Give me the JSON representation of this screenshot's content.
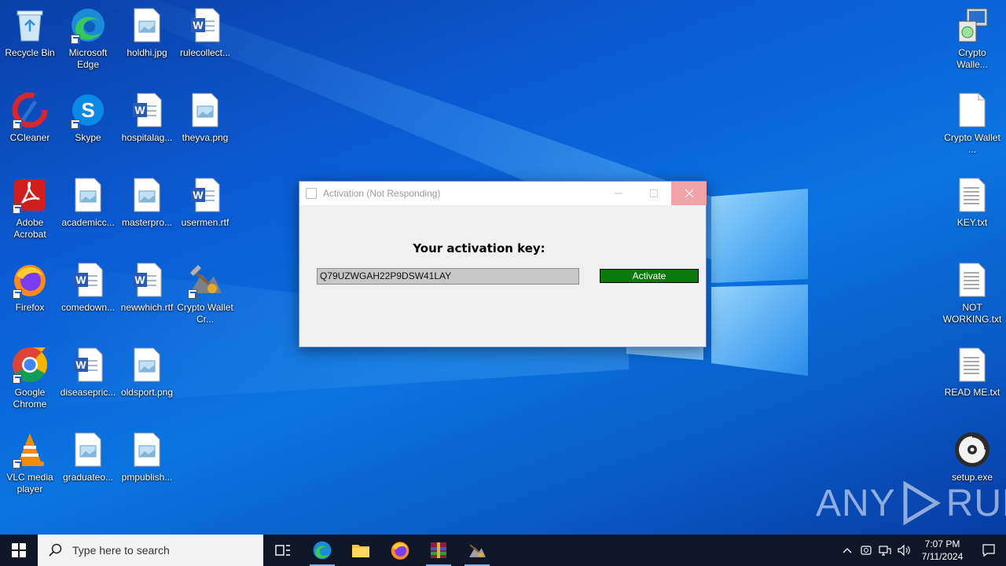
{
  "desktop_icons": [
    {
      "label": "Recycle Bin",
      "icon": "recycle-bin-icon"
    },
    {
      "label": "Microsoft Edge",
      "icon": "edge-icon"
    },
    {
      "label": "holdhi.jpg",
      "icon": "image-file-icon"
    },
    {
      "label": "rulecollect...",
      "icon": "word-doc-icon"
    },
    {
      "label": "CCleaner",
      "icon": "ccleaner-icon"
    },
    {
      "label": "Skype",
      "icon": "skype-icon"
    },
    {
      "label": "hospitalag...",
      "icon": "word-doc-icon"
    },
    {
      "label": "theyva.png",
      "icon": "image-file-icon"
    },
    {
      "label": "Adobe Acrobat",
      "icon": "acrobat-icon"
    },
    {
      "label": "academicc...",
      "icon": "image-file-icon"
    },
    {
      "label": "masterpro...",
      "icon": "image-file-icon"
    },
    {
      "label": "usermen.rtf",
      "icon": "word-doc-icon"
    },
    {
      "label": "Firefox",
      "icon": "firefox-icon"
    },
    {
      "label": "comedown...",
      "icon": "word-doc-icon"
    },
    {
      "label": "newwhich.rtf",
      "icon": "word-doc-icon"
    },
    {
      "label": "Crypto Wallet Cr...",
      "icon": "crypto-wallet-icon"
    },
    {
      "label": "Google Chrome",
      "icon": "chrome-icon"
    },
    {
      "label": "diseasepric...",
      "icon": "word-doc-icon"
    },
    {
      "label": "oldsport.png",
      "icon": "image-file-icon"
    },
    {
      "label": "VLC media player",
      "icon": "vlc-icon"
    },
    {
      "label": "graduateo...",
      "icon": "image-file-icon"
    },
    {
      "label": "pmpublish...",
      "icon": "image-file-icon"
    },
    {
      "label": "Crypto Walle...",
      "icon": "installer-icon"
    },
    {
      "label": "Crypto Wallet ...",
      "icon": "blank-file-icon"
    },
    {
      "label": "KEY.txt",
      "icon": "text-file-icon"
    },
    {
      "label": "NOT WORKING.txt",
      "icon": "text-file-icon"
    },
    {
      "label": "READ ME.txt",
      "icon": "text-file-icon"
    },
    {
      "label": "setup.exe",
      "icon": "disc-setup-icon"
    }
  ],
  "dialog": {
    "title": "Activation (Not Responding)",
    "heading": "Your activation key:",
    "key_value": "Q79UZWGAH22P9DSW41LAY",
    "activate_label": "Activate",
    "activate_color": "#0a7a0a"
  },
  "watermark": {
    "left": "ANY",
    "right": "RUN"
  },
  "taskbar": {
    "search_placeholder": "Type here to search",
    "apps": [
      "task-view-icon",
      "edge-icon",
      "file-explorer-icon",
      "firefox-icon",
      "winrar-icon",
      "crypto-wallet-icon"
    ],
    "time": "7:07 PM",
    "date": "7/11/2024"
  }
}
